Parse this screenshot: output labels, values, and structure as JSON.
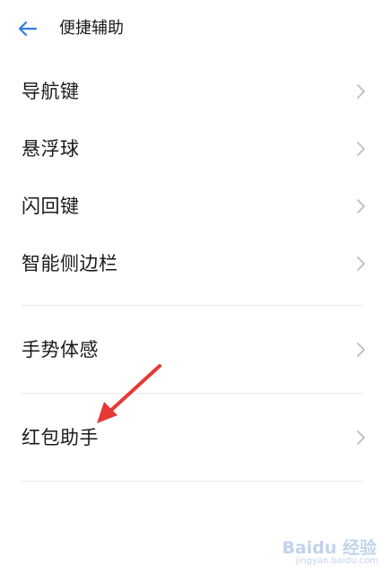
{
  "header": {
    "title": "便捷辅助",
    "back_icon": "back-arrow-icon"
  },
  "settings": {
    "items": [
      {
        "label": "导航键",
        "icon": "chevron-right-icon"
      },
      {
        "label": "悬浮球",
        "icon": "chevron-right-icon"
      },
      {
        "label": "闪回键",
        "icon": "chevron-right-icon"
      },
      {
        "label": "智能侧边栏",
        "icon": "chevron-right-icon"
      },
      {
        "label": "手势体感",
        "icon": "chevron-right-icon"
      },
      {
        "label": "红包助手",
        "icon": "chevron-right-icon"
      }
    ]
  },
  "annotation": {
    "color": "#e53935",
    "icon": "red-arrow-annotation"
  },
  "watermark": {
    "logo": "Baidu 经验",
    "url": "jingyan.baidu.com"
  },
  "colors": {
    "accent": "#2f7de1",
    "text": "#1a1a1a",
    "chevron": "#bdbdbd",
    "divider": "#e9e9e9"
  }
}
